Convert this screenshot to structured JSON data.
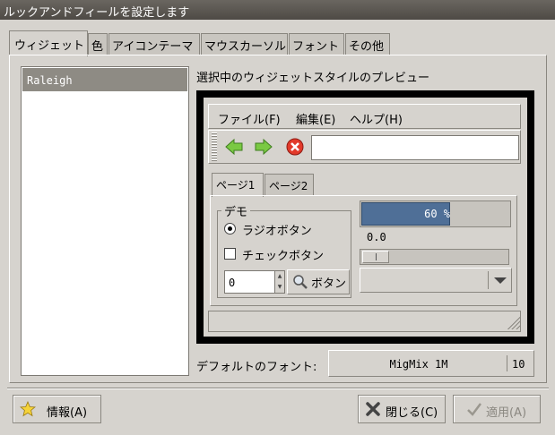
{
  "window": {
    "title": "ルックアンドフィールを設定します"
  },
  "tabs": [
    "ウィジェット",
    "色",
    "アイコンテーマ",
    "マウスカーソル",
    "フォント",
    "その他"
  ],
  "theme_list": {
    "items": [
      "Raleigh"
    ],
    "selected": "Raleigh"
  },
  "preview": {
    "label": "選択中のウィジェットスタイルのプレビュー",
    "menu": [
      "ファイル(F)",
      "編集(E)",
      "ヘルプ(H)"
    ],
    "tabs": [
      "ページ1",
      "ページ2"
    ],
    "demo_frame_label": "デモ",
    "radio_label": "ラジオボタン",
    "check_label": "チェックボタン",
    "spin_value": "0",
    "button_label": "ボタン",
    "progress_text": "60 %",
    "progress_fraction": 0.6,
    "scale_value": "0.0"
  },
  "font": {
    "label": "デフォルトのフォント:",
    "name": "MigMix 1M",
    "size": "10"
  },
  "buttons": {
    "about": "情報(A)",
    "close": "閉じる(C)",
    "apply": "適用(A)"
  },
  "icons": [
    "back-arrow-icon",
    "forward-arrow-icon",
    "stop-icon",
    "search-icon",
    "star-icon",
    "close-x-icon",
    "apply-check-icon"
  ]
}
